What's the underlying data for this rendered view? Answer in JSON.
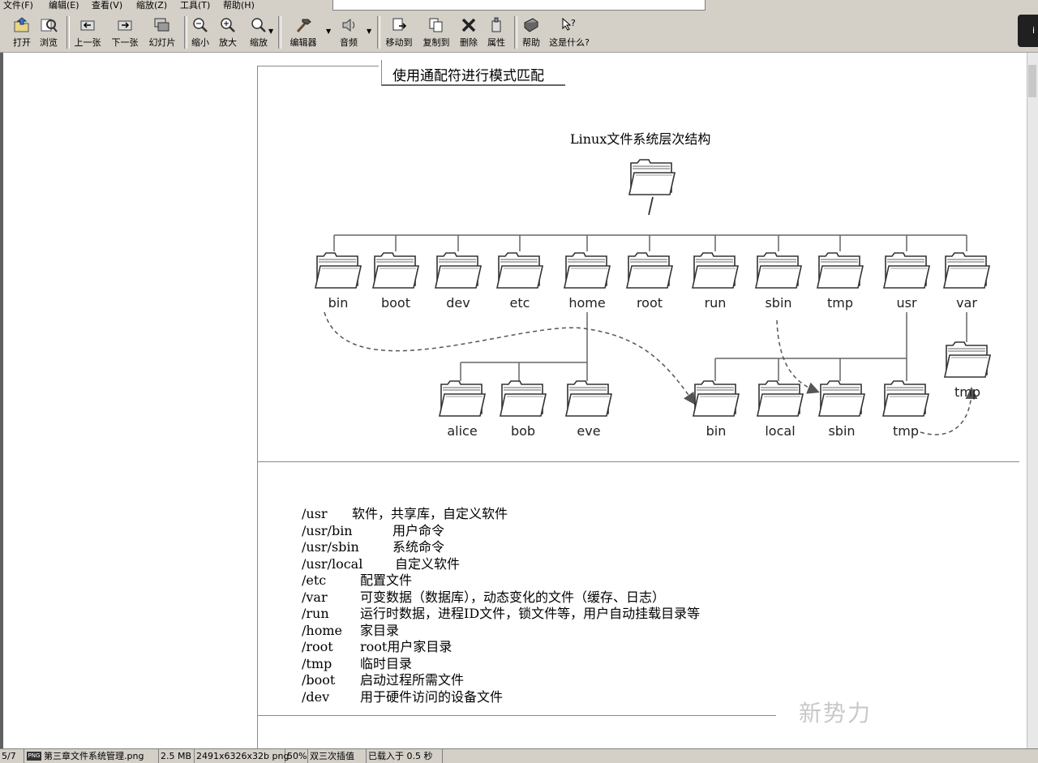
{
  "menu": [
    "文件(F)",
    "编辑(E)",
    "查看(V)",
    "缩放(Z)",
    "工具(T)",
    "帮助(H)"
  ],
  "toolbar": {
    "open": "打开",
    "browse": "浏览",
    "prev": "上一张",
    "next": "下一张",
    "slideshow": "幻灯片",
    "zoom_out": "缩小",
    "zoom_in": "放大",
    "zoom": "缩放",
    "editor": "编辑器",
    "audio": "音频",
    "move_to": "移动到",
    "copy_to": "复制到",
    "delete": "删除",
    "properties": "属性",
    "help": "帮助",
    "whats_this": "这是什么?"
  },
  "page": {
    "heading": "使用通配符进行模式匹配",
    "tree_title": "Linux文件系统层次结构",
    "root_label": "/",
    "level1": [
      "bin",
      "boot",
      "dev",
      "etc",
      "home",
      "root",
      "run",
      "sbin",
      "tmp",
      "usr",
      "var"
    ],
    "home_children": [
      "alice",
      "bob",
      "eve"
    ],
    "usr_children": [
      "bin",
      "local",
      "sbin",
      "tmp"
    ],
    "var_child": "tmp",
    "descriptions": [
      {
        "path": "/usr",
        "text": "软件，共享库，自定义软件"
      },
      {
        "path": "/usr/bin",
        "text": "用户命令"
      },
      {
        "path": "/usr/sbin",
        "text": "系统命令"
      },
      {
        "path": "/usr/local",
        "text": "自定义软件"
      },
      {
        "path": "/etc",
        "text": "配置文件"
      },
      {
        "path": "/var",
        "text": "可变数据（数据库），动态变化的文件（缓存、日志）"
      },
      {
        "path": "/run",
        "text": "运行时数据，进程ID文件，锁文件等，用户自动挂载目录等"
      },
      {
        "path": "/home",
        "text": "家目录"
      },
      {
        "path": "/root",
        "text": "root用户家目录"
      },
      {
        "path": "/tmp",
        "text": "临时目录"
      },
      {
        "path": "/boot",
        "text": "启动过程所需文件"
      },
      {
        "path": "/dev",
        "text": "用于硬件访问的设备文件"
      }
    ]
  },
  "watermark": "新势力",
  "status": {
    "index": "5/7",
    "filename": "第三章文件系统管理.png",
    "filesize": "2.5 MB",
    "dimensions": "2491x6326x32b png",
    "zoom": "50%",
    "resample": "双三次插值",
    "loaded": "已载入于 0.5 秒"
  }
}
